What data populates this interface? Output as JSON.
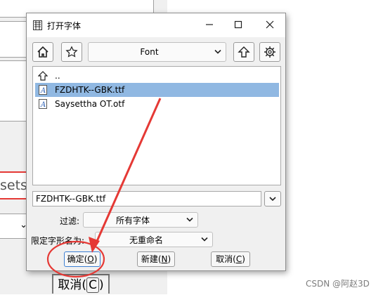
{
  "background_window": {
    "path_fragment": "sets/A",
    "cancel_label": "取消",
    "cancel_key": "C"
  },
  "dialog": {
    "title": "打开字体",
    "toolbar": {
      "home_icon": "home-icon",
      "favorites_icon": "star-icon",
      "location": "Font",
      "up_icon": "up-arrow-icon",
      "settings_icon": "gear-icon"
    },
    "files": [
      {
        "name": "..",
        "icon": "up-arrow-icon",
        "selected": false
      },
      {
        "name": "FZDHTK--GBK.ttf",
        "icon": "font-file-icon",
        "selected": true
      },
      {
        "name": "Saysettha OT.otf",
        "icon": "font-file-icon",
        "selected": false
      }
    ],
    "filename_value": "FZDHTK--GBK.ttf",
    "filter": {
      "label": "过滤:",
      "value": "所有字体"
    },
    "rename": {
      "label": "限定字形名为:",
      "value": "无重命名"
    },
    "buttons": {
      "ok": {
        "label": "确定",
        "key": "O"
      },
      "new": {
        "label": "新建",
        "key": "N"
      },
      "cancel": {
        "label": "取消",
        "key": "C"
      }
    }
  },
  "annotation_colors": {
    "highlight": "#e53935",
    "selection": "#90b8e2"
  },
  "watermark": "CSDN @阿赵3D"
}
